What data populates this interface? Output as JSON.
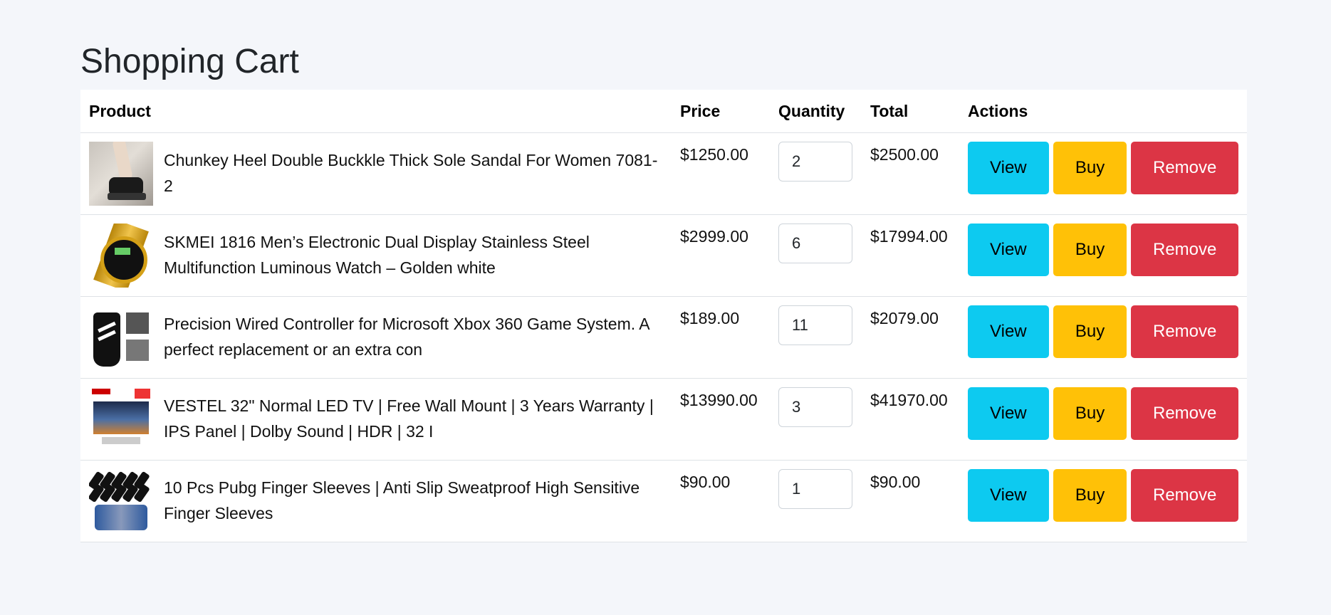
{
  "page": {
    "title": "Shopping Cart"
  },
  "table": {
    "headers": {
      "product": "Product",
      "price": "Price",
      "quantity": "Quantity",
      "total": "Total",
      "actions": "Actions"
    }
  },
  "actions": {
    "view_label": "View",
    "buy_label": "Buy",
    "remove_label": "Remove"
  },
  "colors": {
    "view": "#0dcaf0",
    "buy": "#ffc107",
    "remove": "#dc3545",
    "background": "#f4f6fa"
  },
  "items": [
    {
      "name": "Chunkey Heel Double Buckkle Thick Sole Sandal For Women 7081-2",
      "price": "$1250.00",
      "quantity": "2",
      "total": "$2500.00",
      "thumb": "sandal-image"
    },
    {
      "name": "SKMEI 1816 Men’s Electronic Dual Display Stainless Steel Multifunction Luminous Watch – Golden white",
      "price": "$2999.00",
      "quantity": "6",
      "total": "$17994.00",
      "thumb": "watch-image"
    },
    {
      "name": "Precision Wired Controller for Microsoft Xbox 360 Game System. A perfect replacement or an extra con",
      "price": "$189.00",
      "quantity": "11",
      "total": "$2079.00",
      "thumb": "controller-image"
    },
    {
      "name": "VESTEL 32\" Normal LED TV | Free Wall Mount | 3 Years Warranty | IPS Panel | Dolby Sound | HDR | 32 I",
      "price": "$13990.00",
      "quantity": "3",
      "total": "$41970.00",
      "thumb": "tv-image"
    },
    {
      "name": "10 Pcs Pubg Finger Sleeves | Anti Slip Sweatproof High Sensitive Finger Sleeves",
      "price": "$90.00",
      "quantity": "1",
      "total": "$90.00",
      "thumb": "sleeves-image"
    }
  ]
}
